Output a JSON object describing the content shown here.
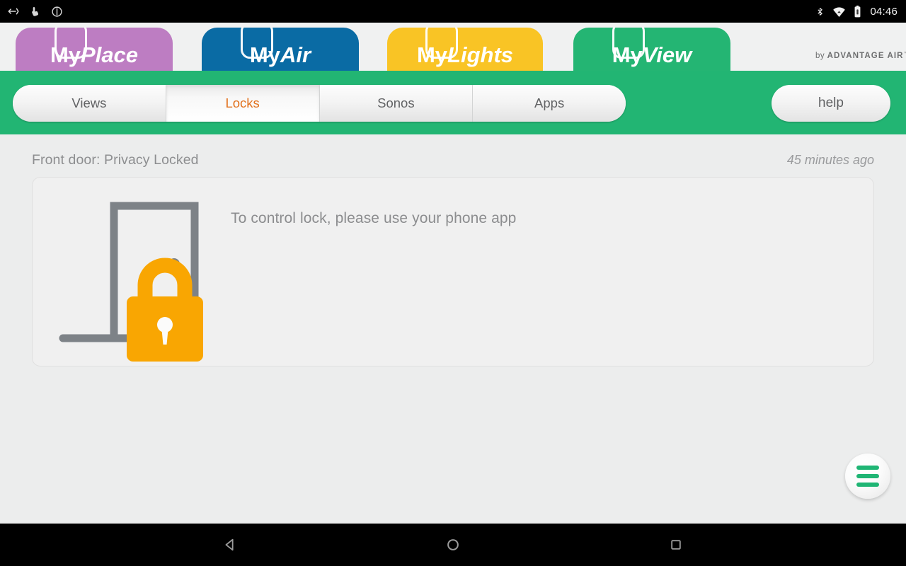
{
  "status_bar": {
    "left_icons": [
      "screen-rotate-icon",
      "touch-pointer-icon",
      "do-not-disturb-icon"
    ],
    "right_icons": [
      "bluetooth-icon",
      "wifi-icon",
      "battery-icon"
    ],
    "clock": "04:46"
  },
  "brand_tabs": [
    {
      "id": "myplace",
      "prefix": "My",
      "suffix": "Place",
      "color": "#bd7dc2",
      "active": false
    },
    {
      "id": "myair",
      "prefix": "My",
      "suffix": "Air",
      "color": "#0a6ba4",
      "active": false
    },
    {
      "id": "mylights",
      "prefix": "My",
      "suffix": "Lights",
      "color": "#f9c425",
      "active": false
    },
    {
      "id": "myview",
      "prefix": "My",
      "suffix": "View",
      "color": "#24b573",
      "active": true
    }
  ],
  "brand_footer": {
    "prefix": "by ",
    "company": "ADVANTAGE AIR",
    "trademark": "™"
  },
  "nav": {
    "accent_color": "#22b573",
    "selected_color": "#e2711d",
    "segments": [
      {
        "id": "views",
        "label": "Views",
        "selected": false
      },
      {
        "id": "locks",
        "label": "Locks",
        "selected": true
      },
      {
        "id": "sonos",
        "label": "Sonos",
        "selected": false
      },
      {
        "id": "apps",
        "label": "Apps",
        "selected": false
      }
    ],
    "help_label": "help"
  },
  "content": {
    "lock_status": "Front door:  Privacy Locked",
    "timestamp": "45 minutes ago",
    "instruction": "To control lock, please use your phone app",
    "door_color": "#7d8287",
    "lock_color": "#f9a602"
  },
  "fab": {
    "icon": "hamburger-menu-icon",
    "color": "#1fb574"
  },
  "android_nav": {
    "back": "back-triangle-icon",
    "home": "home-circle-icon",
    "recents": "recents-square-icon"
  }
}
